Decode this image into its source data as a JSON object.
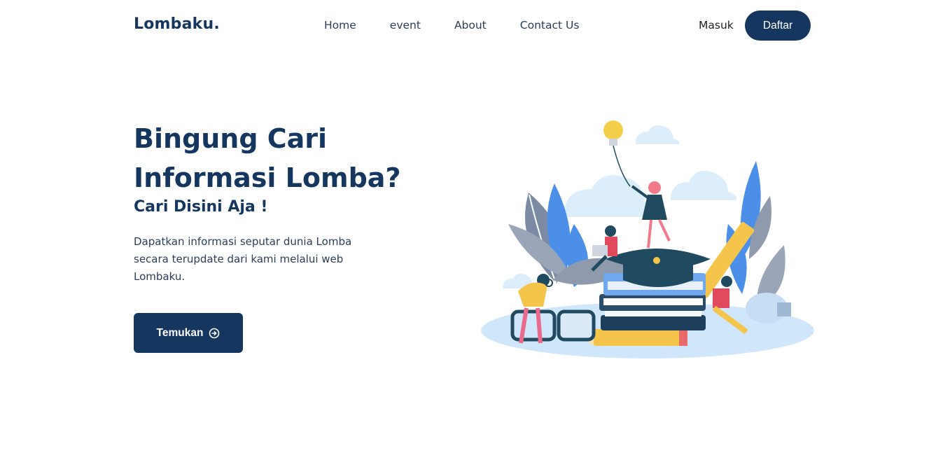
{
  "nav": {
    "brand": "Lombaku.",
    "links": [
      "Home",
      "event",
      "About",
      "Contact Us"
    ],
    "login_label": "Masuk",
    "signup_label": "Daftar"
  },
  "hero": {
    "title_line1": "Bingung Cari",
    "title_line2": "Informasi Lomba?",
    "subtitle": "Cari Disini Aja !",
    "description": "Dapatkan informasi seputar dunia Lomba secara terupdate dari kami melalui web Lombaku.",
    "cta_label": "Temukan",
    "cta_icon": "arrow-circle-right-icon"
  },
  "colors": {
    "primary": "#15365f",
    "text": "#2a3e5a",
    "background": "#ffffff"
  }
}
